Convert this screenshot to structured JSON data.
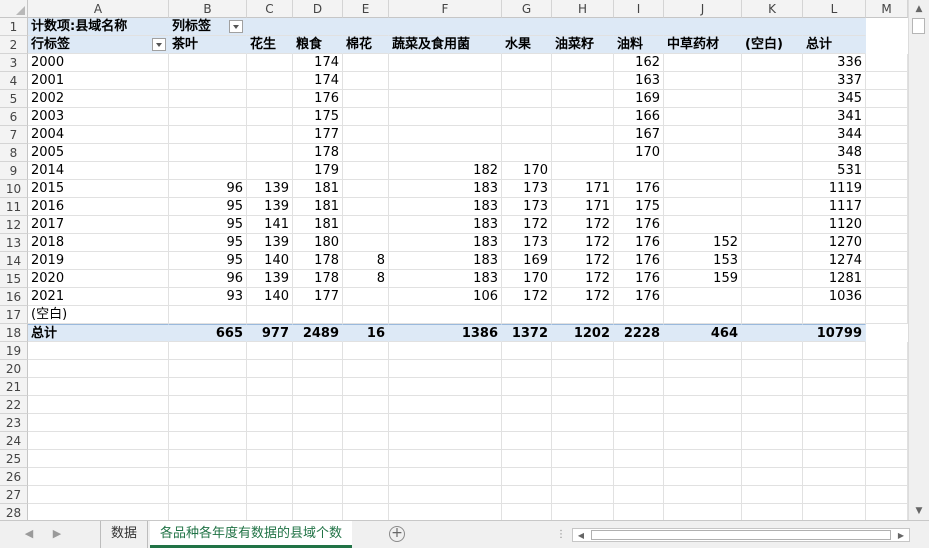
{
  "columns": [
    "A",
    "B",
    "C",
    "D",
    "E",
    "F",
    "G",
    "H",
    "I",
    "J",
    "K",
    "L",
    "M"
  ],
  "row_numbers": [
    "1",
    "2",
    "3",
    "4",
    "5",
    "6",
    "7",
    "8",
    "9",
    "10",
    "11",
    "12",
    "13",
    "14",
    "15",
    "16",
    "17",
    "18",
    "19",
    "20",
    "21",
    "22",
    "23",
    "24",
    "25",
    "26",
    "27",
    "28"
  ],
  "pivot": {
    "value_label": "计数项:县域名称",
    "col_label": "列标签",
    "row_label": "行标签",
    "headers": [
      "茶叶",
      "花生",
      "粮食",
      "棉花",
      "蔬菜及食用菌",
      "水果",
      "油菜籽",
      "油料",
      "中草药材",
      "(空白)",
      "总计"
    ],
    "rows": [
      {
        "year": "2000",
        "values": [
          "",
          "",
          "174",
          "",
          "",
          "",
          "",
          "162",
          "",
          "",
          "336"
        ]
      },
      {
        "year": "2001",
        "values": [
          "",
          "",
          "174",
          "",
          "",
          "",
          "",
          "163",
          "",
          "",
          "337"
        ]
      },
      {
        "year": "2002",
        "values": [
          "",
          "",
          "176",
          "",
          "",
          "",
          "",
          "169",
          "",
          "",
          "345"
        ]
      },
      {
        "year": "2003",
        "values": [
          "",
          "",
          "175",
          "",
          "",
          "",
          "",
          "166",
          "",
          "",
          "341"
        ]
      },
      {
        "year": "2004",
        "values": [
          "",
          "",
          "177",
          "",
          "",
          "",
          "",
          "167",
          "",
          "",
          "344"
        ]
      },
      {
        "year": "2005",
        "values": [
          "",
          "",
          "178",
          "",
          "",
          "",
          "",
          "170",
          "",
          "",
          "348"
        ]
      },
      {
        "year": "2014",
        "values": [
          "",
          "",
          "179",
          "",
          "182",
          "170",
          "",
          "",
          "",
          "",
          "531"
        ]
      },
      {
        "year": "2015",
        "values": [
          "96",
          "139",
          "181",
          "",
          "183",
          "173",
          "171",
          "176",
          "",
          "",
          "1119"
        ]
      },
      {
        "year": "2016",
        "values": [
          "95",
          "139",
          "181",
          "",
          "183",
          "173",
          "171",
          "175",
          "",
          "",
          "1117"
        ]
      },
      {
        "year": "2017",
        "values": [
          "95",
          "141",
          "181",
          "",
          "183",
          "172",
          "172",
          "176",
          "",
          "",
          "1120"
        ]
      },
      {
        "year": "2018",
        "values": [
          "95",
          "139",
          "180",
          "",
          "183",
          "173",
          "172",
          "176",
          "152",
          "",
          "1270"
        ]
      },
      {
        "year": "2019",
        "values": [
          "95",
          "140",
          "178",
          "8",
          "183",
          "169",
          "172",
          "176",
          "153",
          "",
          "1274"
        ]
      },
      {
        "year": "2020",
        "values": [
          "96",
          "139",
          "178",
          "8",
          "183",
          "170",
          "172",
          "176",
          "159",
          "",
          "1281"
        ]
      },
      {
        "year": "2021",
        "values": [
          "93",
          "140",
          "177",
          "",
          "106",
          "172",
          "172",
          "176",
          "",
          "",
          "1036"
        ]
      },
      {
        "year": "(空白)",
        "values": [
          "",
          "",
          "",
          "",
          "",
          "",
          "",
          "",
          "",
          "",
          ""
        ]
      }
    ],
    "total": {
      "label": "总计",
      "values": [
        "665",
        "977",
        "2489",
        "16",
        "1386",
        "1372",
        "1202",
        "2228",
        "464",
        "",
        "10799"
      ]
    }
  },
  "sheet_tabs": [
    "数据",
    "各品种各年度有数据的县域个数"
  ],
  "active_tab_index": 1,
  "icons": {
    "prev": "chevron-left-icon",
    "next": "chevron-right-icon",
    "add": "plus-circle-icon"
  },
  "colors": {
    "accent": "#217346",
    "pivot_band": "#dde9f6"
  }
}
